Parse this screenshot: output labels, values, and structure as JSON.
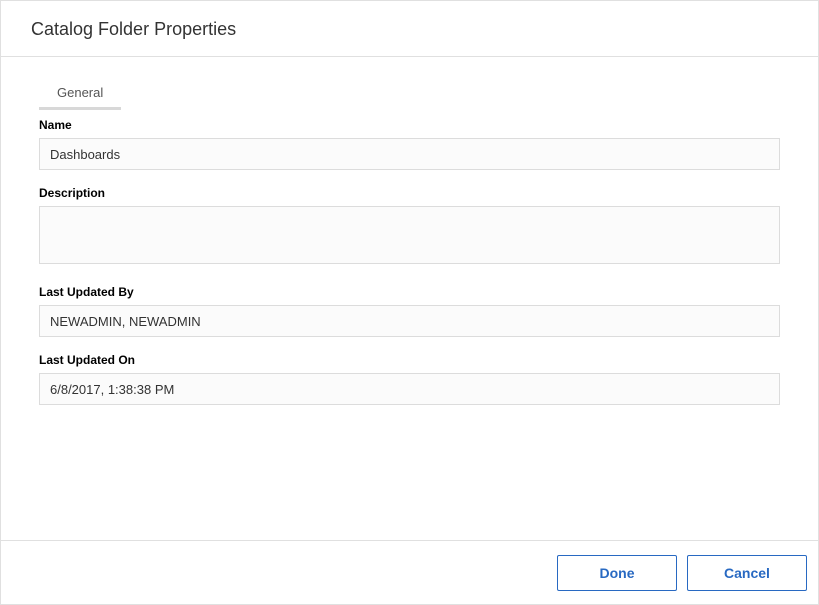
{
  "header": {
    "title": "Catalog Folder Properties"
  },
  "tabs": {
    "general": "General"
  },
  "form": {
    "name_label": "Name",
    "name_value": "Dashboards",
    "description_label": "Description",
    "description_value": "",
    "updated_by_label": "Last Updated By",
    "updated_by_value": "NEWADMIN, NEWADMIN",
    "updated_on_label": "Last Updated On",
    "updated_on_value": "6/8/2017, 1:38:38 PM"
  },
  "footer": {
    "done_label": "Done",
    "cancel_label": "Cancel"
  }
}
